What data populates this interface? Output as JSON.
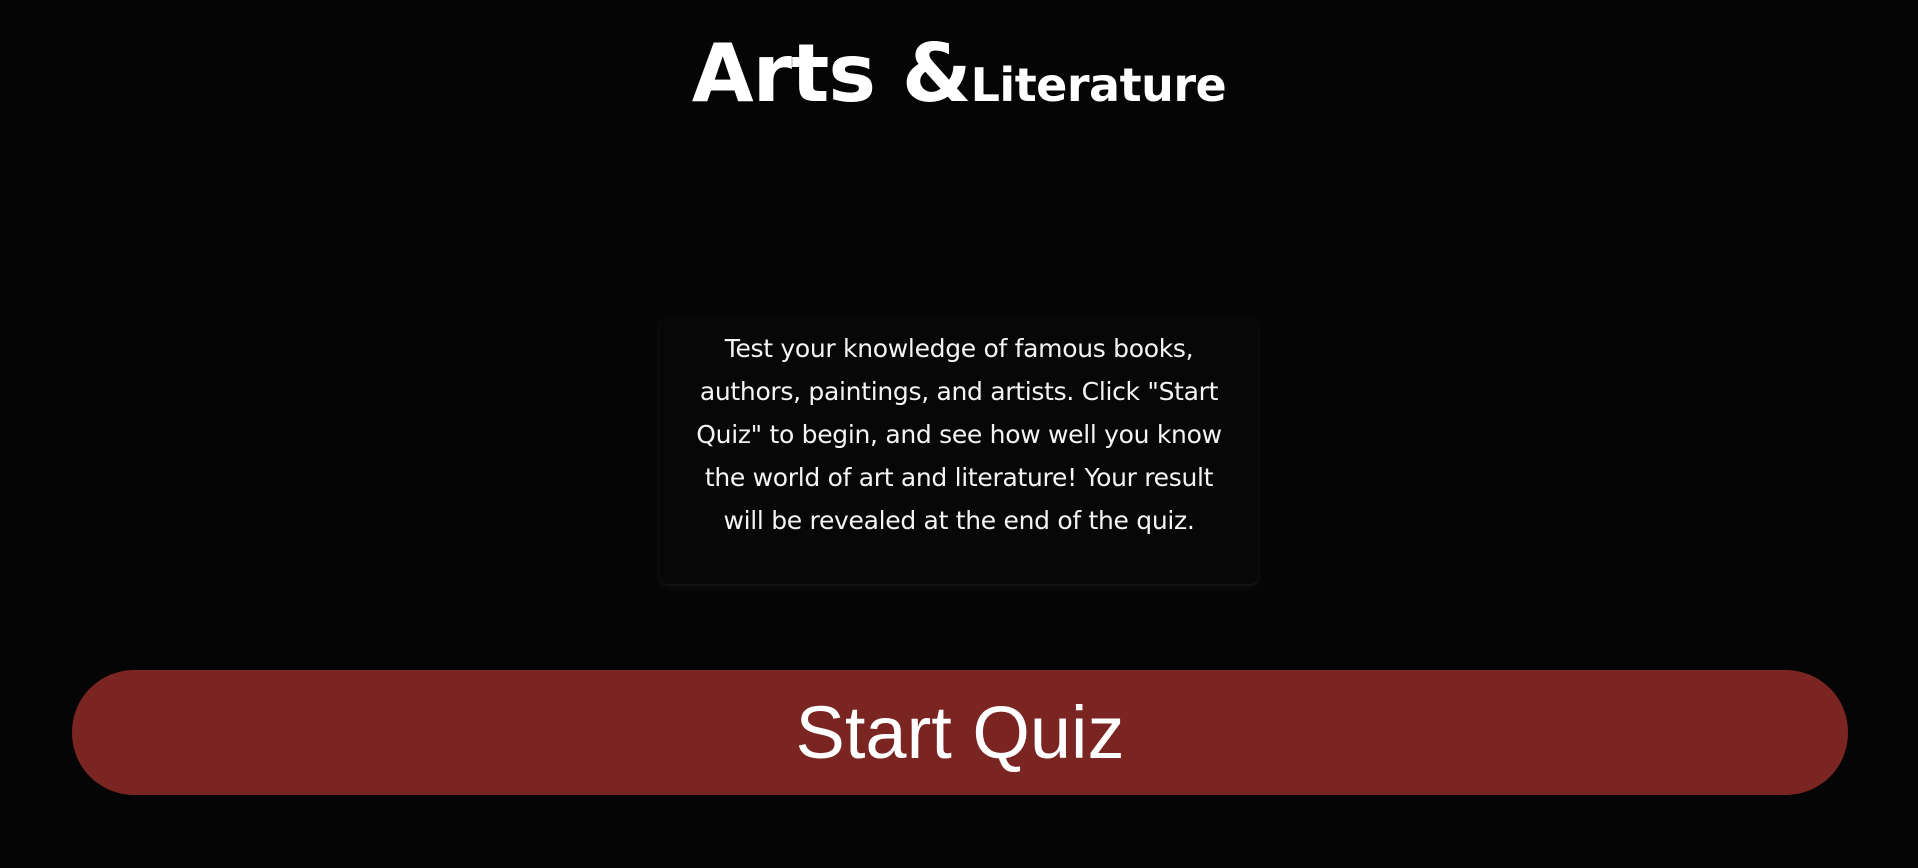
{
  "header": {
    "title_main": "Arts &",
    "title_sub": "Literature"
  },
  "intro": {
    "text": "Test your knowledge of famous books, authors, paintings, and artists. Click \"Start Quiz\" to begin, and see how well you know the world of art and literature! Your result will be revealed at the end of the quiz."
  },
  "actions": {
    "start_label": "Start Quiz"
  },
  "colors": {
    "background": "#050505",
    "button": "#7b2523",
    "text": "#ffffff"
  }
}
